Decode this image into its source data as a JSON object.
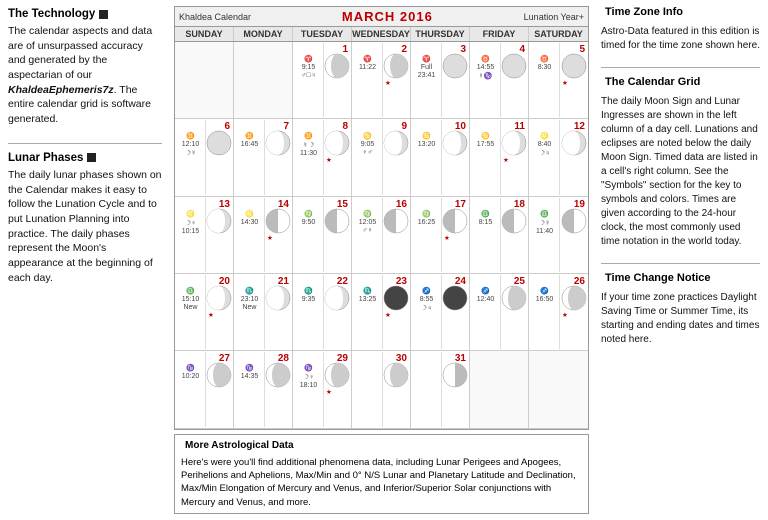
{
  "left": {
    "tech_title": "The Technology",
    "tech_body_1": "The calendar aspects and data are of unsurpassed accuracy and generated by the aspectarian of our ",
    "tech_brand": "KhaldeaEphemeris7z",
    "tech_body_2": ". The entire calendar grid is software generated.",
    "lunar_title": "Lunar Phases",
    "lunar_body": "The daily lunar phases shown on the Calendar makes it easy to follow the Lunation Cycle and to put Lunation Planning into practice. The daily phases represent the Moon's appearance at the beginning of each day."
  },
  "calendar": {
    "brand_left": "Khaldea Calendar",
    "title": "MARCH 2016",
    "brand_right": "Lunation Year+",
    "days": [
      "SUNDAY",
      "MONDAY",
      "TUESDAY",
      "WEDNESDAY",
      "THURSDAY",
      "FRIDAY",
      "SATURDAY"
    ],
    "cells": [
      {
        "num": "",
        "empty": true
      },
      {
        "num": "",
        "empty": true
      },
      {
        "num": "1",
        "moon": "waxing"
      },
      {
        "num": "2",
        "moon": "waxing"
      },
      {
        "num": "3",
        "moon": "full"
      },
      {
        "num": "4",
        "moon": "full"
      },
      {
        "num": "5",
        "moon": "full"
      },
      {
        "num": "6",
        "moon": "full"
      },
      {
        "num": "7",
        "moon": "waning"
      },
      {
        "num": "8",
        "moon": "waning"
      },
      {
        "num": "9",
        "moon": "waning"
      },
      {
        "num": "10",
        "moon": "waning"
      },
      {
        "num": "11",
        "moon": "waning"
      },
      {
        "num": "12",
        "moon": "waning"
      },
      {
        "num": "13",
        "moon": "waning"
      },
      {
        "num": "14",
        "moon": "half-left"
      },
      {
        "num": "15",
        "moon": "half-left"
      },
      {
        "num": "16",
        "moon": "half-left"
      },
      {
        "num": "17",
        "moon": "half-left"
      },
      {
        "num": "18",
        "moon": "half-left"
      },
      {
        "num": "19",
        "moon": "half-left"
      },
      {
        "num": "20",
        "moon": "waning"
      },
      {
        "num": "21",
        "moon": "waning"
      },
      {
        "num": "22",
        "moon": "waning"
      },
      {
        "num": "23",
        "moon": "new"
      },
      {
        "num": "24",
        "moon": "new"
      },
      {
        "num": "25",
        "moon": "waxing"
      },
      {
        "num": "26",
        "moon": "waxing"
      },
      {
        "num": "27",
        "moon": "waxing"
      },
      {
        "num": "28",
        "moon": "waxing"
      },
      {
        "num": "29",
        "moon": "waxing"
      },
      {
        "num": "30",
        "moon": "waxing"
      },
      {
        "num": "31",
        "moon": "half-right"
      },
      {
        "num": "",
        "empty": true
      },
      {
        "num": "",
        "empty": true
      }
    ]
  },
  "more_data": {
    "title": "More Astrological Data",
    "body": "Here's were you'll find additional phenomena data, including Lunar Perigees and Apogees, Perihelions and Aphelions, Max/Min and 0° N/S Lunar and Planetary Latitude and Declination, Max/Min Elongation of Mercury and Venus, and Inferior/Superior Solar conjunctions with Mercury and Venus, and more."
  },
  "right": {
    "tz_title": "Time Zone Info",
    "tz_body": "Astro-Data featured in this edition is timed for the time zone shown here.",
    "grid_title": "The Calendar Grid",
    "grid_body": "The daily Moon Sign and Lunar Ingresses are shown in the left column of a day cell. Lunations and eclipses are noted below the daily Moon Sign. Timed data are listed in a cell's right column. See the \"Symbols\" section for the key to symbols and colors. Times are given according to the 24-hour clock, the most commonly used time notation in the world today.",
    "tc_title": "Time Change Notice",
    "tc_body": "If your time zone practices Daylight Saving Time or Summer Time, its starting and ending dates and times noted here."
  },
  "colors": {
    "accent_red": "#b00000",
    "sq_icon": "#222222",
    "border": "#999999"
  }
}
